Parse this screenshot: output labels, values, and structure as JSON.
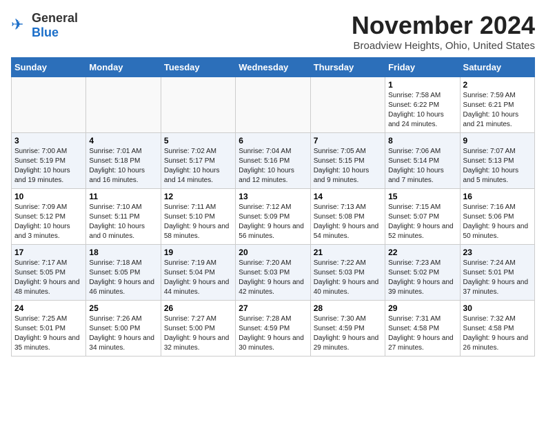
{
  "header": {
    "logo_general": "General",
    "logo_blue": "Blue",
    "title": "November 2024",
    "subtitle": "Broadview Heights, Ohio, United States"
  },
  "days_of_week": [
    "Sunday",
    "Monday",
    "Tuesday",
    "Wednesday",
    "Thursday",
    "Friday",
    "Saturday"
  ],
  "weeks": [
    [
      {
        "day": "",
        "info": ""
      },
      {
        "day": "",
        "info": ""
      },
      {
        "day": "",
        "info": ""
      },
      {
        "day": "",
        "info": ""
      },
      {
        "day": "",
        "info": ""
      },
      {
        "day": "1",
        "info": "Sunrise: 7:58 AM\nSunset: 6:22 PM\nDaylight: 10 hours and 24 minutes."
      },
      {
        "day": "2",
        "info": "Sunrise: 7:59 AM\nSunset: 6:21 PM\nDaylight: 10 hours and 21 minutes."
      }
    ],
    [
      {
        "day": "3",
        "info": "Sunrise: 7:00 AM\nSunset: 5:19 PM\nDaylight: 10 hours and 19 minutes."
      },
      {
        "day": "4",
        "info": "Sunrise: 7:01 AM\nSunset: 5:18 PM\nDaylight: 10 hours and 16 minutes."
      },
      {
        "day": "5",
        "info": "Sunrise: 7:02 AM\nSunset: 5:17 PM\nDaylight: 10 hours and 14 minutes."
      },
      {
        "day": "6",
        "info": "Sunrise: 7:04 AM\nSunset: 5:16 PM\nDaylight: 10 hours and 12 minutes."
      },
      {
        "day": "7",
        "info": "Sunrise: 7:05 AM\nSunset: 5:15 PM\nDaylight: 10 hours and 9 minutes."
      },
      {
        "day": "8",
        "info": "Sunrise: 7:06 AM\nSunset: 5:14 PM\nDaylight: 10 hours and 7 minutes."
      },
      {
        "day": "9",
        "info": "Sunrise: 7:07 AM\nSunset: 5:13 PM\nDaylight: 10 hours and 5 minutes."
      }
    ],
    [
      {
        "day": "10",
        "info": "Sunrise: 7:09 AM\nSunset: 5:12 PM\nDaylight: 10 hours and 3 minutes."
      },
      {
        "day": "11",
        "info": "Sunrise: 7:10 AM\nSunset: 5:11 PM\nDaylight: 10 hours and 0 minutes."
      },
      {
        "day": "12",
        "info": "Sunrise: 7:11 AM\nSunset: 5:10 PM\nDaylight: 9 hours and 58 minutes."
      },
      {
        "day": "13",
        "info": "Sunrise: 7:12 AM\nSunset: 5:09 PM\nDaylight: 9 hours and 56 minutes."
      },
      {
        "day": "14",
        "info": "Sunrise: 7:13 AM\nSunset: 5:08 PM\nDaylight: 9 hours and 54 minutes."
      },
      {
        "day": "15",
        "info": "Sunrise: 7:15 AM\nSunset: 5:07 PM\nDaylight: 9 hours and 52 minutes."
      },
      {
        "day": "16",
        "info": "Sunrise: 7:16 AM\nSunset: 5:06 PM\nDaylight: 9 hours and 50 minutes."
      }
    ],
    [
      {
        "day": "17",
        "info": "Sunrise: 7:17 AM\nSunset: 5:05 PM\nDaylight: 9 hours and 48 minutes."
      },
      {
        "day": "18",
        "info": "Sunrise: 7:18 AM\nSunset: 5:05 PM\nDaylight: 9 hours and 46 minutes."
      },
      {
        "day": "19",
        "info": "Sunrise: 7:19 AM\nSunset: 5:04 PM\nDaylight: 9 hours and 44 minutes."
      },
      {
        "day": "20",
        "info": "Sunrise: 7:20 AM\nSunset: 5:03 PM\nDaylight: 9 hours and 42 minutes."
      },
      {
        "day": "21",
        "info": "Sunrise: 7:22 AM\nSunset: 5:03 PM\nDaylight: 9 hours and 40 minutes."
      },
      {
        "day": "22",
        "info": "Sunrise: 7:23 AM\nSunset: 5:02 PM\nDaylight: 9 hours and 39 minutes."
      },
      {
        "day": "23",
        "info": "Sunrise: 7:24 AM\nSunset: 5:01 PM\nDaylight: 9 hours and 37 minutes."
      }
    ],
    [
      {
        "day": "24",
        "info": "Sunrise: 7:25 AM\nSunset: 5:01 PM\nDaylight: 9 hours and 35 minutes."
      },
      {
        "day": "25",
        "info": "Sunrise: 7:26 AM\nSunset: 5:00 PM\nDaylight: 9 hours and 34 minutes."
      },
      {
        "day": "26",
        "info": "Sunrise: 7:27 AM\nSunset: 5:00 PM\nDaylight: 9 hours and 32 minutes."
      },
      {
        "day": "27",
        "info": "Sunrise: 7:28 AM\nSunset: 4:59 PM\nDaylight: 9 hours and 30 minutes."
      },
      {
        "day": "28",
        "info": "Sunrise: 7:30 AM\nSunset: 4:59 PM\nDaylight: 9 hours and 29 minutes."
      },
      {
        "day": "29",
        "info": "Sunrise: 7:31 AM\nSunset: 4:58 PM\nDaylight: 9 hours and 27 minutes."
      },
      {
        "day": "30",
        "info": "Sunrise: 7:32 AM\nSunset: 4:58 PM\nDaylight: 9 hours and 26 minutes."
      }
    ]
  ]
}
